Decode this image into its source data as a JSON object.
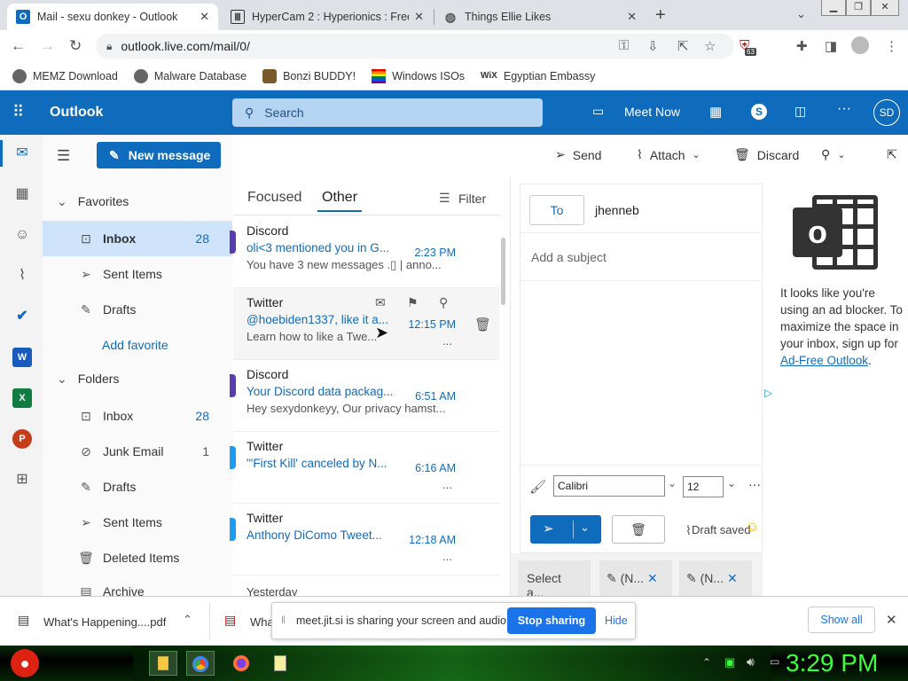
{
  "browser": {
    "tabs": [
      {
        "title": "Mail - sexu donkey - Outlook",
        "active": true
      },
      {
        "title": "HyperCam 2 : Hyperionics : Free",
        "active": false
      },
      {
        "title": "Things Ellie Likes",
        "active": false
      }
    ],
    "url": "outlook.live.com/mail/0/",
    "extension_badge": "63",
    "bookmarks": [
      "MEMZ Download",
      "Malware Database",
      "Bonzi BUDDY!",
      "Windows ISOs",
      "Egyptian Embassy"
    ]
  },
  "outlook": {
    "brand": "Outlook",
    "search_placeholder": "Search",
    "meet_now": "Meet Now",
    "avatar_initials": "SD",
    "new_message": "New message",
    "favorites_label": "Favorites",
    "folders_label": "Folders",
    "favorites": [
      {
        "name": "Inbox",
        "count": "28",
        "icon": "inbox-icon"
      },
      {
        "name": "Sent Items",
        "count": "",
        "icon": "send-icon"
      },
      {
        "name": "Drafts",
        "count": "",
        "icon": "pencil-icon"
      }
    ],
    "add_favorite": "Add favorite",
    "folders": [
      {
        "name": "Inbox",
        "count": "28",
        "icon": "inbox-icon"
      },
      {
        "name": "Junk Email",
        "count": "1",
        "icon": "junk-icon"
      },
      {
        "name": "Drafts",
        "count": "",
        "icon": "pencil-icon"
      },
      {
        "name": "Sent Items",
        "count": "",
        "icon": "send-icon"
      },
      {
        "name": "Deleted Items",
        "count": "",
        "icon": "trash-icon"
      },
      {
        "name": "Archive",
        "count": "",
        "icon": "archive-icon"
      }
    ],
    "list_tabs": {
      "focused": "Focused",
      "other": "Other",
      "filter": "Filter"
    },
    "messages": [
      {
        "from": "Discord",
        "subject": "oli<3 mentioned you in G...",
        "time": "2:23 PM",
        "preview": "You have 3 new messages .▯ | anno..."
      },
      {
        "from": "Twitter",
        "subject": "@hoebiden1337, like it a...",
        "time": "12:15 PM",
        "preview": "Learn how to like a Twe...",
        "more": "..."
      },
      {
        "from": "Discord",
        "subject": "Your Discord data packag...",
        "time": "6:51 AM",
        "preview": "Hey sexydonkeyy, Our privacy hamst..."
      },
      {
        "from": "Twitter",
        "subject": "\"'First Kill' canceled by N...",
        "time": "6:16 AM",
        "preview": "",
        "more": "..."
      },
      {
        "from": "Twitter",
        "subject": "Anthony DiComo Tweet...",
        "time": "12:18 AM",
        "preview": "",
        "more": "..."
      }
    ],
    "group_label": "Yesterday",
    "commands": {
      "send": "Send",
      "attach": "Attach",
      "discard": "Discard"
    },
    "compose": {
      "to_label": "To",
      "to_value": "jhenneb",
      "subject_placeholder": "Add a subject",
      "font": "Calibri",
      "size": "12",
      "draft_status": "Draft saved"
    },
    "draft_tabs": [
      "Select a...",
      "(N...",
      "(N..."
    ],
    "ad": {
      "text": "It looks like you're using an ad blocker. To maximize the space in your inbox, sign up for",
      "link": "Ad-Free Outlook",
      "end": "."
    }
  },
  "downloads": {
    "items": [
      "What's Happening....pdf",
      "Wha"
    ],
    "show_all": "Show all"
  },
  "sharing": {
    "message": "meet.jit.si is sharing your screen and audio.",
    "stop": "Stop sharing",
    "hide": "Hide"
  },
  "taskbar": {
    "clock": "3:29 PM"
  },
  "colors": {
    "outlook_blue": "#0f6cbd",
    "clock_green": "#3bff3b"
  }
}
